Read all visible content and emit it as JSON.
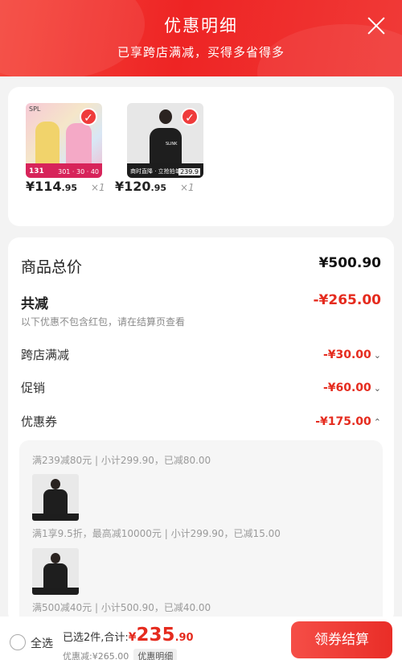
{
  "header": {
    "title": "优惠明细",
    "subtitle": "已享跨店满减，买得多省得多"
  },
  "products": [
    {
      "price_main": "¥114",
      "price_dec": ".95",
      "qty": "×1",
      "thumb_tag": "131",
      "thumb_tag2": "301 · 30 · 40",
      "brand": "SPL"
    },
    {
      "price_main": "¥120",
      "price_dec": ".95",
      "qty": "×1",
      "thumb_tag": "商时直降 · 立抢拍单",
      "thumb_tag2": "239.9",
      "brand": "SLINK"
    }
  ],
  "summary": {
    "total_label": "商品总价",
    "total_value": "¥500.90",
    "reduce_label": "共减",
    "reduce_value": "-¥265.00",
    "note": "以下优惠不包含红包，请在结算页查看",
    "items": [
      {
        "label": "跨店满减",
        "value": "-¥30.00",
        "arrow": "⌄"
      },
      {
        "label": "促销",
        "value": "-¥60.00",
        "arrow": "⌄"
      },
      {
        "label": "优惠券",
        "value": "-¥175.00",
        "arrow": "⌃"
      }
    ]
  },
  "coupons": [
    {
      "text": "满239减80元 | 小计299.90，已减80.00"
    },
    {
      "text": "满1享9.5折，最高减10000元 | 小计299.90，已减15.00"
    },
    {
      "text": "满500减40元 | 小计500.90，已减40.00"
    }
  ],
  "bottom": {
    "select_all": "全选",
    "selected_prefix": "已选2件,合计:",
    "yen": "¥",
    "total_int": "235",
    "total_dec": ".90",
    "discount_text": "优惠减:¥265.00",
    "detail_tag": "优惠明细",
    "checkout_label": "领券结算"
  },
  "colors": {
    "accent": "#ee2424",
    "price_red": "#e52b1e"
  }
}
